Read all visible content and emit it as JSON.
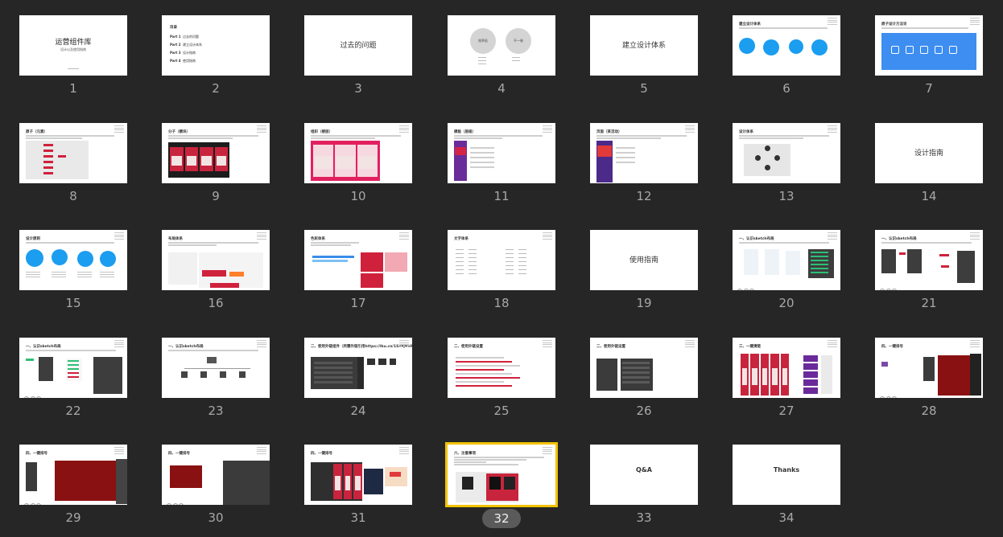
{
  "app": {
    "selected_slide": 32
  },
  "slides": [
    {
      "num": "1",
      "type": "cover",
      "title": "运营组件库",
      "subtitle": "设计以及使用指南"
    },
    {
      "num": "2",
      "type": "agenda",
      "title": "目录",
      "items": [
        {
          "part": "Part 1",
          "label": "过去的问题"
        },
        {
          "part": "Part 2",
          "label": "建立设计体系"
        },
        {
          "part": "Part 3",
          "label": "设计指南"
        },
        {
          "part": "Part 4",
          "label": "使用指南"
        }
      ]
    },
    {
      "num": "3",
      "type": "section",
      "title": "过去的问题"
    },
    {
      "num": "4",
      "type": "two-circles",
      "labels": [
        "效率低",
        "不一致"
      ]
    },
    {
      "num": "5",
      "type": "section",
      "title": "建立设计体系"
    },
    {
      "num": "6",
      "type": "blue-circles",
      "title": "建立设计体系"
    },
    {
      "num": "7",
      "type": "blue-box",
      "title": "原子设计方法论"
    },
    {
      "num": "8",
      "type": "content",
      "title": "原子（元素）"
    },
    {
      "num": "9",
      "type": "content",
      "title": "分子（模块）"
    },
    {
      "num": "10",
      "type": "content",
      "title": "组织（楼层）"
    },
    {
      "num": "11",
      "type": "content",
      "title": "模板（层级）"
    },
    {
      "num": "12",
      "type": "content",
      "title": "页面（某活动）"
    },
    {
      "num": "13",
      "type": "content",
      "title": "设计体系"
    },
    {
      "num": "14",
      "type": "section",
      "title": "设计指南"
    },
    {
      "num": "15",
      "type": "blue-circles",
      "title": "设计原则"
    },
    {
      "num": "16",
      "type": "content",
      "title": "布局体系"
    },
    {
      "num": "17",
      "type": "content",
      "title": "色彩体系"
    },
    {
      "num": "18",
      "type": "content",
      "title": "文字体系"
    },
    {
      "num": "19",
      "type": "section",
      "title": "使用指南"
    },
    {
      "num": "20",
      "type": "content",
      "title": "一、认识sketch布局"
    },
    {
      "num": "21",
      "type": "content",
      "title": "一、认识sketch布局"
    },
    {
      "num": "22",
      "type": "content",
      "title": "一、认识sketch布局"
    },
    {
      "num": "23",
      "type": "content",
      "title": "一、认识sketch布局"
    },
    {
      "num": "24",
      "type": "content",
      "title": "二、使用外链组件（所需外链引用https://lku.cn/1Sx9jBxW）"
    },
    {
      "num": "25",
      "type": "content",
      "title": "二、使用外链设置"
    },
    {
      "num": "26",
      "type": "content",
      "title": "二、使用外链设置"
    },
    {
      "num": "27",
      "type": "content",
      "title": "三、一键清楚"
    },
    {
      "num": "28",
      "type": "content",
      "title": "四、一键排号"
    },
    {
      "num": "29",
      "type": "content",
      "title": "四、一键排号"
    },
    {
      "num": "30",
      "type": "content",
      "title": "四、一键排号"
    },
    {
      "num": "31",
      "type": "content",
      "title": "四、一键排号"
    },
    {
      "num": "32",
      "type": "content",
      "title": "六、注意事项"
    },
    {
      "num": "33",
      "type": "section",
      "title": "Q&A"
    },
    {
      "num": "34",
      "type": "section",
      "title": "Thanks"
    }
  ],
  "colors": {
    "background": "#262626",
    "selection": "#f2c200",
    "accent_blue": "#1b9df0",
    "brand_red": "#d0213c"
  }
}
